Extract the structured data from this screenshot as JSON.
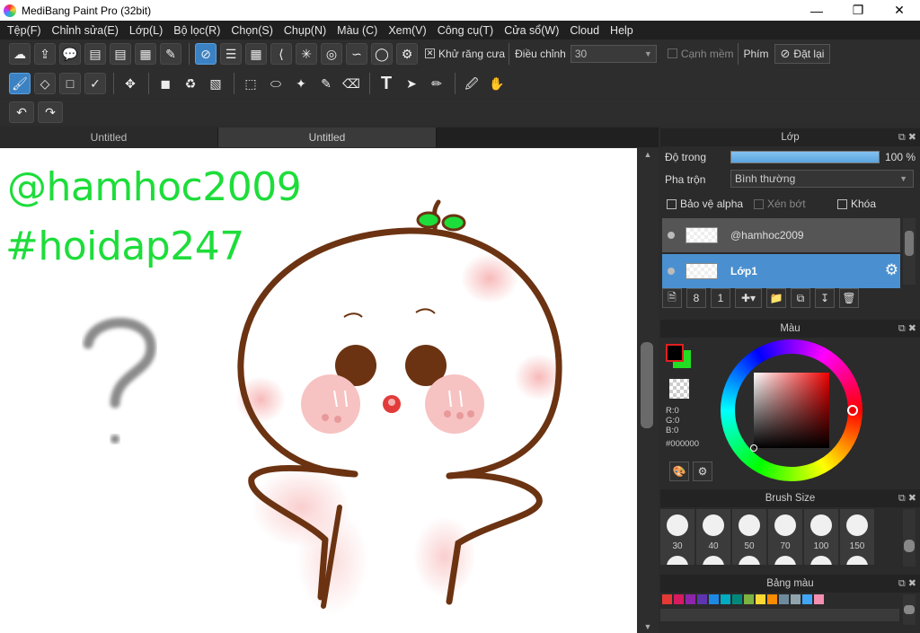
{
  "window": {
    "title": "MediBang Paint Pro (32bit)",
    "minimize_icon": "minimize-icon",
    "maximize_icon": "maximize-icon",
    "close_icon": "close-icon"
  },
  "menu": [
    "Tệp(F)",
    "Chỉnh sửa(E)",
    "Lớp(L)",
    "Bộ lọc(R)",
    "Chọn(S)",
    "Chụp(N)",
    "Màu (C)",
    "Xem(V)",
    "Công cụ(T)",
    "Cửa sổ(W)",
    "Cloud",
    "Help"
  ],
  "toolbar": {
    "antialias_label": "Khử răng cưa",
    "adjust_label": "Điều chỉnh",
    "adjust_value": "30",
    "soft_edge_label": "Cạnh mềm",
    "key_label": "Phím",
    "reset_label": "Đặt lại"
  },
  "tabs": [
    "Untitled",
    "Untitled"
  ],
  "canvas": {
    "text1": "@hamhoc2009",
    "text2": "#hoidap247",
    "text_color": "#1ddd3a"
  },
  "layer_panel": {
    "title": "Lớp",
    "opacity_label": "Độ trong",
    "opacity_value": "100 %",
    "opacity": 1.0,
    "blend_label": "Pha trộn",
    "blend_value": "Bình thường",
    "protect_alpha_label": "Bảo vệ alpha",
    "clip_label": "Xén bớt",
    "lock_label": "Khóa",
    "layers": [
      {
        "name": "@hamhoc2009",
        "selected": false
      },
      {
        "name": "Lớp1",
        "selected": true
      }
    ]
  },
  "color_panel": {
    "title": "Màu",
    "r_label": "R:0",
    "g_label": "G:0",
    "b_label": "B:0",
    "hex": "#000000",
    "foreground": "#000000",
    "background": "#22dd22"
  },
  "brush_panel": {
    "title": "Brush Size",
    "sizes": [
      "30",
      "40",
      "50",
      "70",
      "100",
      "150"
    ]
  },
  "palette_panel": {
    "title": "Bảng màu",
    "swatches": [
      "#e53935",
      "#d81b60",
      "#8e24aa",
      "#5e35b1",
      "#1e88e5",
      "#00acc1",
      "#00897b",
      "#7cb342",
      "#fdd835",
      "#fb8c00",
      "#6d8b9c",
      "#90a4ae",
      "#42a5f5",
      "#f48fb1"
    ]
  }
}
